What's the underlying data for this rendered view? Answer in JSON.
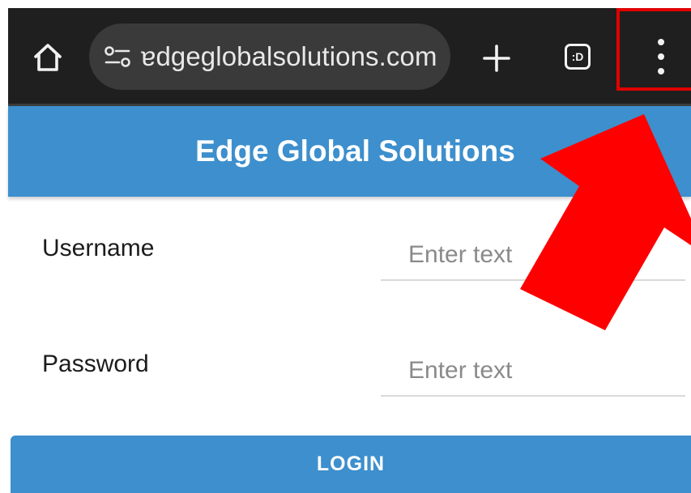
{
  "browser": {
    "url": "ɐdgeglobalsolutions.com",
    "tab_count_label": ":D"
  },
  "app": {
    "title": "Edge Global Solutions"
  },
  "form": {
    "username_label": "Username",
    "username_placeholder": "Enter text",
    "password_label": "Password",
    "password_placeholder": "Enter text",
    "login_label": "LOGIN"
  },
  "colors": {
    "browser_bar": "#1f1f1f",
    "app_blue": "#3d8fcd",
    "highlight_red": "#e00000",
    "arrow_red": "#ff0000"
  },
  "icons": [
    "home-icon",
    "tune-icon",
    "plus-icon",
    "tab-switcher-icon",
    "more-vert-icon",
    "red-arrow-icon"
  ]
}
